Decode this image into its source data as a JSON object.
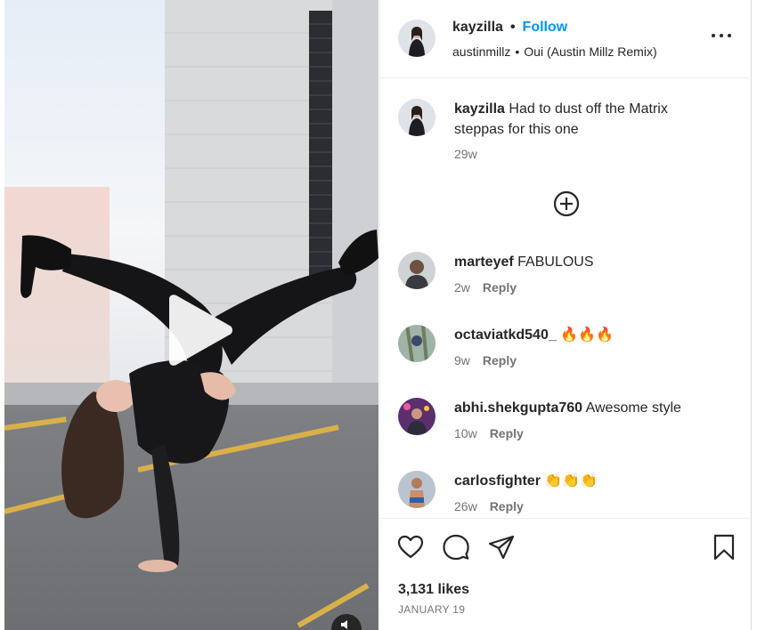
{
  "post": {
    "author": "kayzilla",
    "follow_label": "Follow",
    "separator": "•",
    "audio_artist": "austinmillz",
    "audio_track": "Oui (Austin Millz Remix)"
  },
  "caption": {
    "user": "kayzilla",
    "text": "Had to dust off the Matrix steppas for this one",
    "time": "29w"
  },
  "comments": [
    {
      "user": "marteyef",
      "text": "FABULOUS",
      "time": "2w",
      "reply": "Reply"
    },
    {
      "user": "octaviatkd540_",
      "text": "🔥🔥🔥",
      "time": "9w",
      "reply": "Reply"
    },
    {
      "user": "abhi.shekgupta760",
      "text": "Awesome style",
      "time": "10w",
      "reply": "Reply"
    },
    {
      "user": "carlosfighter",
      "text": "👏👏👏",
      "time": "26w",
      "reply": "Reply"
    }
  ],
  "engagement": {
    "likes": "3,131 likes",
    "date": "JANUARY 19"
  },
  "icons": {
    "play": "play-icon",
    "sound": "sound-icon",
    "more": "more-options-icon",
    "load_more": "plus-circle-icon",
    "like": "heart-icon",
    "comment": "comment-icon",
    "share": "paper-plane-icon",
    "save": "bookmark-icon"
  },
  "colors": {
    "accent": "#0095f6",
    "text": "#262626",
    "secondary": "#737373"
  }
}
